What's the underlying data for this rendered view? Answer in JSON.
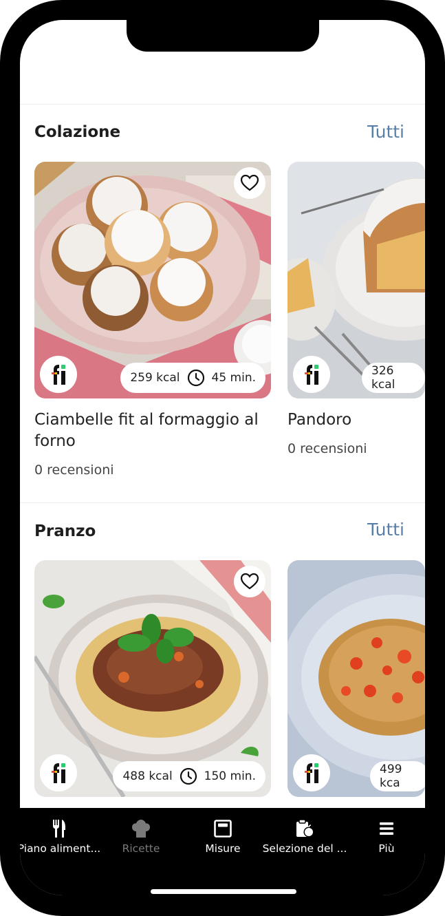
{
  "sections": [
    {
      "title": "Colazione",
      "link": "Tutti",
      "recipes": [
        {
          "title": "Ciambelle fit al formaggio al forno",
          "kcal": "259 kcal",
          "time": "45 min.",
          "reviews": "0 recensioni"
        },
        {
          "title": "Pandoro",
          "kcal": "326 kcal",
          "reviews": "0 recensioni"
        }
      ]
    },
    {
      "title": "Pranzo",
      "link": "Tutti",
      "recipes": [
        {
          "kcal": "488 kcal",
          "time": "150 min."
        },
        {
          "kcal": "499 kca"
        }
      ]
    }
  ],
  "tabbar": {
    "items": [
      {
        "label": "Piano aliment...",
        "icon": "fork-knife-icon"
      },
      {
        "label": "Ricette",
        "icon": "chef-hat-icon"
      },
      {
        "label": "Misure",
        "icon": "scale-icon"
      },
      {
        "label": "Selezione del ...",
        "icon": "clipboard-apple-icon"
      },
      {
        "label": "Più",
        "icon": "menu-icon"
      }
    ]
  },
  "colors": {
    "accent_link": "#5a7fa6",
    "tab_inactive": "#7a7a7a"
  }
}
